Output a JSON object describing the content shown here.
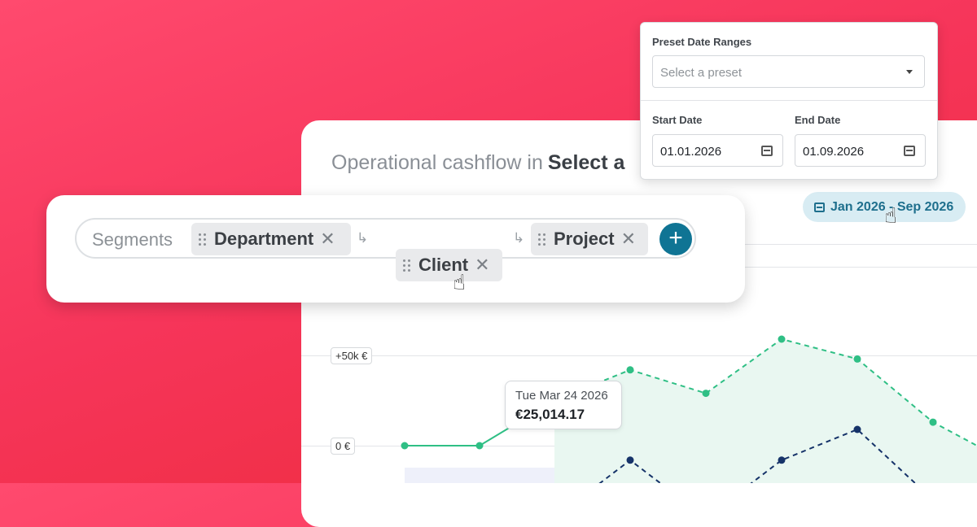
{
  "main": {
    "title": "Operational cashflow in",
    "title_select": "Select a",
    "date_range_pill": "Jan 2026 - Sep 2026"
  },
  "segments": {
    "label": "Segments",
    "chips": [
      "Department",
      "Client",
      "Project"
    ],
    "add_label": "+"
  },
  "preset": {
    "label": "Preset Date Ranges",
    "placeholder": "Select a preset",
    "start_label": "Start Date",
    "start_value": "01.01.2026",
    "end_label": "End Date",
    "end_value": "01.09.2026"
  },
  "chart": {
    "y_labels": [
      "+50k €",
      "0 €"
    ],
    "tooltip_date": "Tue Mar 24 2026",
    "tooltip_value": "€25,014.17",
    "colors": {
      "green": "#2fbf85",
      "navy": "#163369"
    }
  },
  "chart_data": {
    "type": "line",
    "series": [
      {
        "name": "",
        "style": "solid-then-dashed",
        "values": [
          0,
          0,
          25014.17,
          42000,
          29000,
          59000,
          48000,
          13000,
          0
        ]
      },
      {
        "name": "",
        "style": "dashed",
        "values": [
          -40000,
          -40000,
          -40000,
          -8000,
          -40000,
          -8000,
          9000,
          -30000,
          -40000
        ]
      }
    ],
    "ylim": [
      -40000,
      100000
    ],
    "y_ticks": [
      "+50k €",
      "0 €"
    ]
  }
}
